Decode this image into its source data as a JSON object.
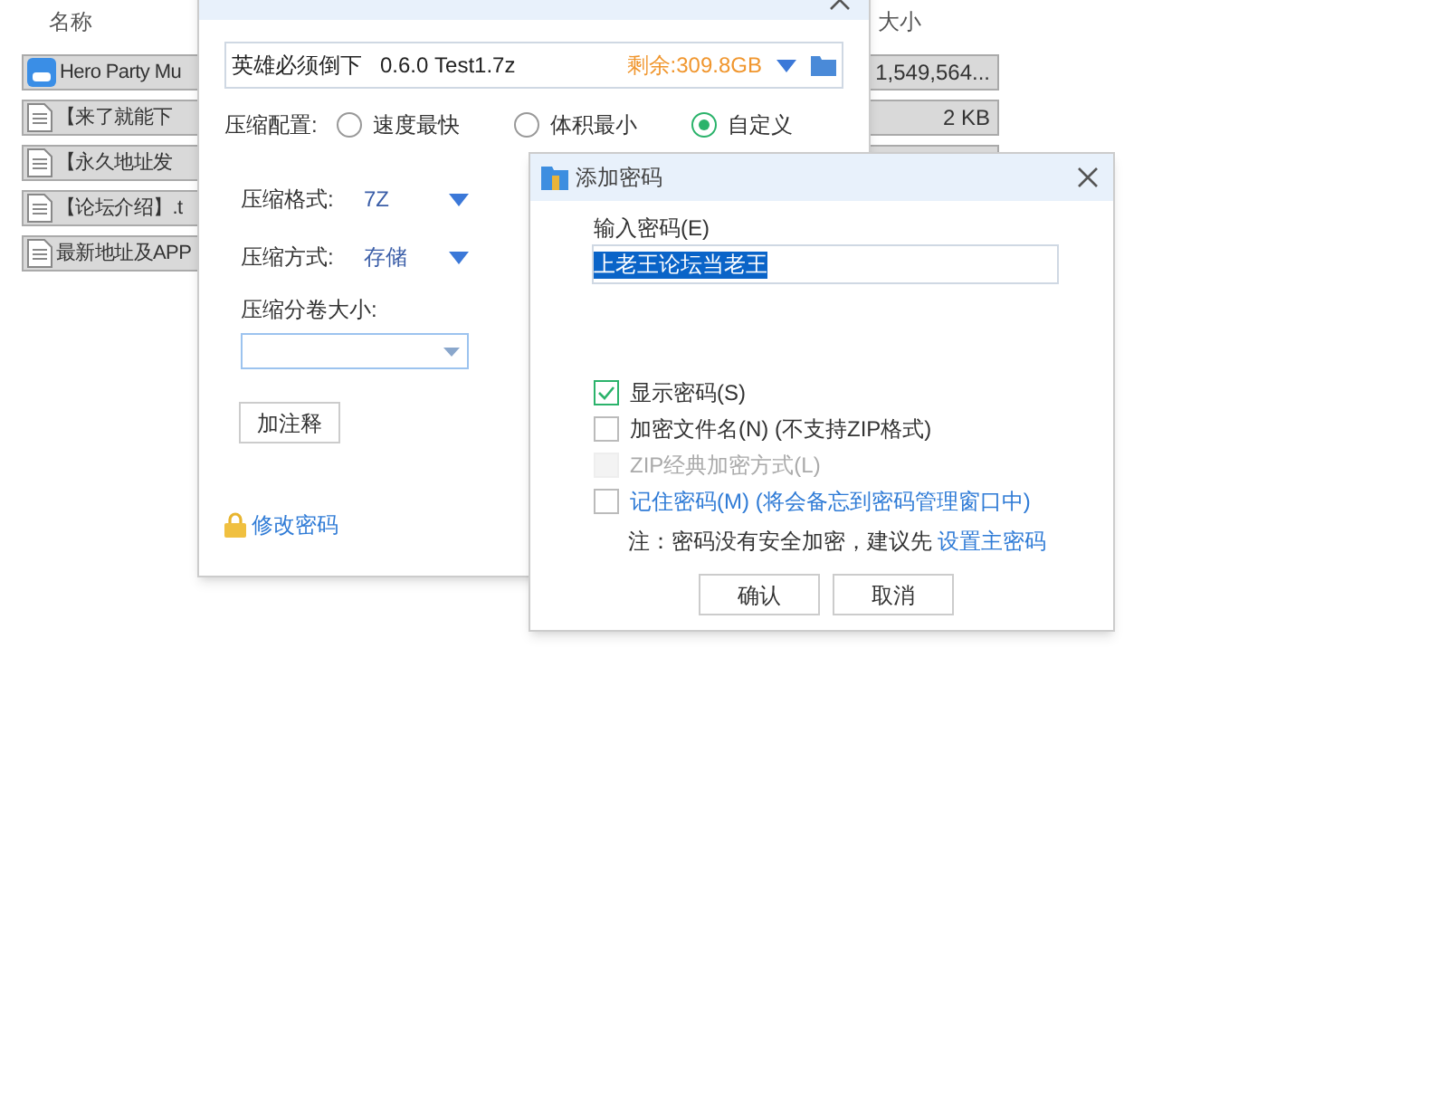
{
  "file_list": {
    "columns": [
      "名称",
      "大小"
    ],
    "rows": [
      {
        "name": "Hero Party Mu",
        "size": "1,549,564...",
        "kind": "app"
      },
      {
        "name": "【来了就能下",
        "size": "2 KB",
        "kind": "text"
      },
      {
        "name": "【永久地址发",
        "kind": "text"
      },
      {
        "name": "【论坛介绍】.t",
        "kind": "text"
      },
      {
        "name": "最新地址及APP",
        "kind": "text"
      }
    ]
  },
  "compress_dialog": {
    "path": "英雄必须倒下   0.6.0 Test1.7z",
    "free_space": "剩余:309.8GB",
    "profile_label": "压缩配置:",
    "profiles": [
      {
        "label": "速度最快",
        "selected": false
      },
      {
        "label": "体积最小",
        "selected": false
      },
      {
        "label": "自定义",
        "selected": true
      }
    ],
    "format_label": "压缩格式:",
    "format": "7Z",
    "method_label": "压缩方式:",
    "method": "存储",
    "volume_label": "压缩分卷大小:",
    "comment_button": "加注释",
    "change_password_link": "修改密码"
  },
  "password_dialog": {
    "title": "添加密码",
    "input_label": "输入密码(E)",
    "password": "上老王论坛当老王",
    "options": [
      {
        "label": "显示密码(S)",
        "checked": true,
        "disabled": false,
        "kind": "normal"
      },
      {
        "label": "加密文件名(N) (不支持ZIP格式)",
        "checked": false,
        "disabled": false,
        "kind": "normal"
      },
      {
        "label": "ZIP经典加密方式(L)",
        "checked": false,
        "disabled": true,
        "kind": "normal"
      },
      {
        "label": "记住密码(M) (将会备忘到密码管理窗口中)",
        "checked": false,
        "disabled": false,
        "kind": "link"
      }
    ],
    "note": "注：密码没有安全加密，建议先",
    "note_link": "设置主密码",
    "buttons": [
      "确认",
      "取消"
    ]
  }
}
